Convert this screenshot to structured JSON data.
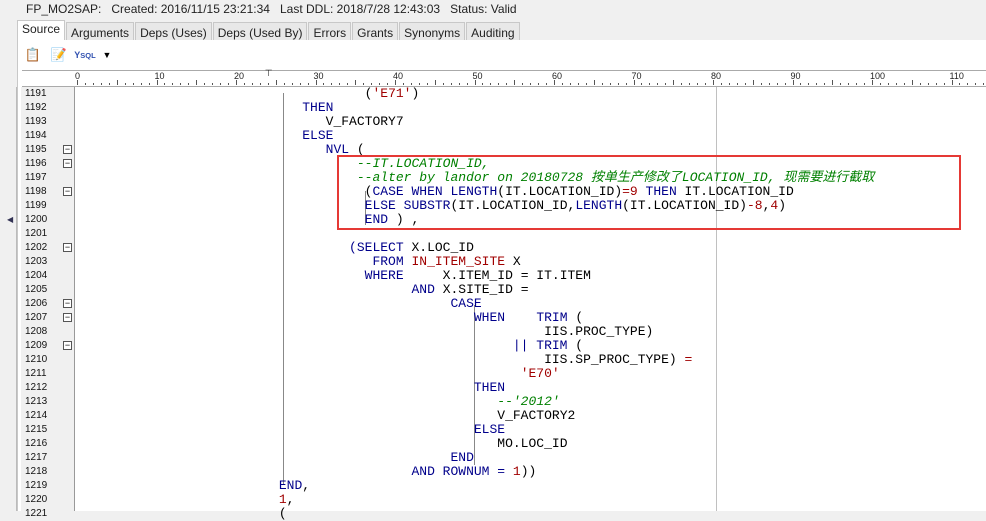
{
  "header": {
    "object": "FP_MO2SAP:",
    "created": "Created: 2016/11/15 23:21:34",
    "last_ddl": "Last DDL: 2018/7/28 12:43:03",
    "status": "Status: Valid"
  },
  "tabs": [
    "Source",
    "Arguments",
    "Deps (Uses)",
    "Deps (Used By)",
    "Errors",
    "Grants",
    "Synonyms",
    "Auditing"
  ],
  "active_tab": "Source",
  "toolbar": [
    "clipboard-icon",
    "edit-icon",
    "sql-format-icon",
    "dropdown-arrow-icon"
  ],
  "ruler": [
    "0",
    "10",
    "20",
    "30",
    "40",
    "50",
    "60",
    "70",
    "80",
    "90",
    "100",
    "110"
  ],
  "highlight_color": "#e53935",
  "lines": [
    {
      "n": "1191",
      "t": [
        [
          "                                     ",
          "id"
        ],
        [
          "(",
          "id"
        ],
        [
          "'E71'",
          "str"
        ],
        [
          ")",
          "id"
        ]
      ]
    },
    {
      "n": "1192",
      "t": [
        [
          "                             ",
          "id"
        ],
        [
          "THEN",
          "kw"
        ]
      ]
    },
    {
      "n": "1193",
      "t": [
        [
          "                                ",
          "id"
        ],
        [
          "V_FACTORY7",
          "id"
        ]
      ]
    },
    {
      "n": "1194",
      "t": [
        [
          "                             ",
          "id"
        ],
        [
          "ELSE",
          "kw"
        ]
      ]
    },
    {
      "n": "1195",
      "fold": true,
      "t": [
        [
          "                                ",
          "id"
        ],
        [
          "NVL",
          "kw"
        ],
        [
          " (",
          "id"
        ]
      ]
    },
    {
      "n": "1196",
      "fold": true,
      "t": [
        [
          "                                    ",
          "id"
        ],
        [
          "--IT.LOCATION_ID,",
          "cm"
        ]
      ]
    },
    {
      "n": "1197",
      "t": [
        [
          "                                    ",
          "id"
        ],
        [
          "--alter by landor on 20180728 按单生产修改了LOCATION_ID, 现需要进行截取",
          "cm"
        ]
      ]
    },
    {
      "n": "1198",
      "fold": true,
      "t": [
        [
          "                                     ",
          "id"
        ],
        [
          "(",
          "id"
        ],
        [
          "CASE WHEN LENGTH",
          "kw"
        ],
        [
          "(IT.LOCATION_ID)",
          "id"
        ],
        [
          "=9",
          "op"
        ],
        [
          " THEN ",
          "kw"
        ],
        [
          "IT.LOCATION_ID",
          "id"
        ]
      ]
    },
    {
      "n": "1199",
      "t": [
        [
          "                                     ",
          "id"
        ],
        [
          "ELSE SUBSTR",
          "kw"
        ],
        [
          "(IT.LOCATION_ID,",
          "id"
        ],
        [
          "LENGTH",
          "kw"
        ],
        [
          "(IT.LOCATION_ID)",
          "id"
        ],
        [
          "-8",
          "op"
        ],
        [
          ",",
          "id"
        ],
        [
          "4",
          "num"
        ],
        [
          ")",
          "id"
        ]
      ]
    },
    {
      "n": "1200",
      "t": [
        [
          "                                     ",
          "id"
        ],
        [
          "END",
          "kw"
        ],
        [
          " ) ,",
          "id"
        ]
      ]
    },
    {
      "n": "1201",
      "t": []
    },
    {
      "n": "1202",
      "fold": true,
      "t": [
        [
          "                                   ",
          "id"
        ],
        [
          "(SELECT ",
          "kw"
        ],
        [
          "X.LOC_ID",
          "id"
        ]
      ]
    },
    {
      "n": "1203",
      "t": [
        [
          "                                      ",
          "id"
        ],
        [
          "FROM ",
          "kw"
        ],
        [
          "IN_ITEM_SITE",
          "op"
        ],
        [
          " X",
          "id"
        ]
      ]
    },
    {
      "n": "1204",
      "t": [
        [
          "                                     ",
          "id"
        ],
        [
          "WHERE",
          "kw"
        ],
        [
          "     X.ITEM_ID = IT.ITEM",
          "id"
        ]
      ]
    },
    {
      "n": "1205",
      "t": [
        [
          "                                           ",
          "id"
        ],
        [
          "AND ",
          "kw"
        ],
        [
          "X.SITE_ID =",
          "id"
        ]
      ]
    },
    {
      "n": "1206",
      "fold": true,
      "t": [
        [
          "                                                ",
          "id"
        ],
        [
          "CASE",
          "kw"
        ]
      ]
    },
    {
      "n": "1207",
      "fold": true,
      "t": [
        [
          "                                                   ",
          "id"
        ],
        [
          "WHEN",
          "kw"
        ],
        [
          "    ",
          "id"
        ],
        [
          "TRIM",
          "kw"
        ],
        [
          " (",
          "id"
        ]
      ]
    },
    {
      "n": "1208",
      "t": [
        [
          "                                                            ",
          "id"
        ],
        [
          "IIS.PROC_TYPE)",
          "id"
        ]
      ]
    },
    {
      "n": "1209",
      "fold": true,
      "t": [
        [
          "                                                        ",
          "id"
        ],
        [
          "|| TRIM",
          "kw"
        ],
        [
          " (",
          "id"
        ]
      ]
    },
    {
      "n": "1210",
      "t": [
        [
          "                                                            ",
          "id"
        ],
        [
          "IIS.SP_PROC_TYPE)",
          "id"
        ],
        [
          " =",
          "op"
        ]
      ]
    },
    {
      "n": "1211",
      "t": [
        [
          "                                                         ",
          "id"
        ],
        [
          "'E70'",
          "str"
        ]
      ]
    },
    {
      "n": "1212",
      "t": [
        [
          "                                                   ",
          "id"
        ],
        [
          "THEN",
          "kw"
        ]
      ]
    },
    {
      "n": "1213",
      "t": [
        [
          "                                                      ",
          "id"
        ],
        [
          "--'2012'",
          "cm"
        ]
      ]
    },
    {
      "n": "1214",
      "t": [
        [
          "                                                      ",
          "id"
        ],
        [
          "V_FACTORY2",
          "id"
        ]
      ]
    },
    {
      "n": "1215",
      "t": [
        [
          "                                                   ",
          "id"
        ],
        [
          "ELSE",
          "kw"
        ]
      ]
    },
    {
      "n": "1216",
      "t": [
        [
          "                                                      ",
          "id"
        ],
        [
          "MO.LOC_ID",
          "id"
        ]
      ]
    },
    {
      "n": "1217",
      "t": [
        [
          "                                                ",
          "id"
        ],
        [
          "END",
          "kw"
        ]
      ]
    },
    {
      "n": "1218",
      "t": [
        [
          "                                           ",
          "id"
        ],
        [
          "AND ROWNUM = ",
          "kw"
        ],
        [
          "1",
          "num"
        ],
        [
          "))",
          "id"
        ]
      ]
    },
    {
      "n": "1219",
      "t": [
        [
          "                          ",
          "id"
        ],
        [
          "END",
          "kw"
        ],
        [
          ",",
          "id"
        ]
      ]
    },
    {
      "n": "1220",
      "t": [
        [
          "                          ",
          "id"
        ],
        [
          "1",
          "num"
        ],
        [
          ",",
          "id"
        ]
      ]
    },
    {
      "n": "1221",
      "t": [
        [
          "                          ",
          "id"
        ],
        [
          "(",
          "id"
        ]
      ]
    }
  ]
}
